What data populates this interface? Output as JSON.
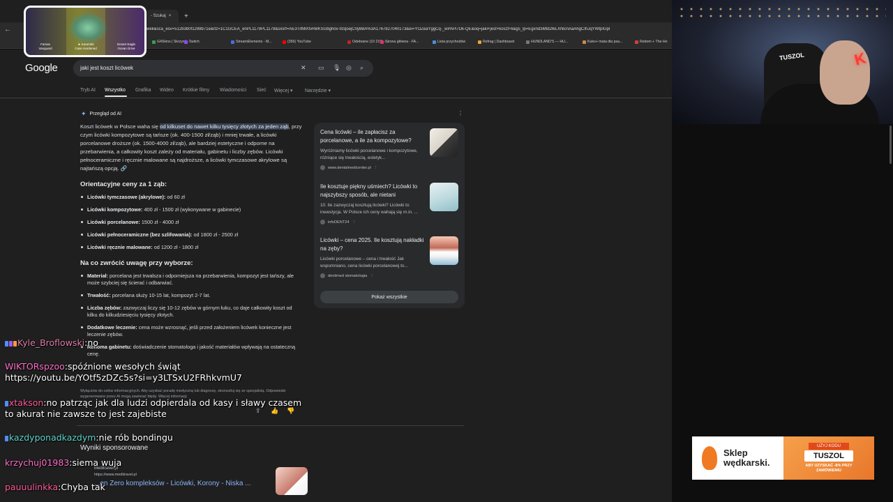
{
  "browser": {
    "tab_label": "- Szukaj",
    "new_tab": "+",
    "url": "wek&sca_esv=512b3b0f1298b71e&rlz=1C1GCEA_enPL1179PL1179&sxsrf=AE3TifMlXtvRBKSGbghov-9zqoejC0y8BA%3A1767827040173&ei=YOZeaYggCq-_wPAPi7Dk-QE&oq=jaki+jest+koszt+li&gs_lp=Egxnd3Mtd2l6LXNlcnAaAhgCIhJqYWtpIGpl",
    "bookmarks": [
      "G4Skins | Skrzynki -...",
      "Twitch",
      "StreamElements - M...",
      "(356) YouTube",
      "Odebrane (10 219) -...",
      "Strona główna - FA...",
      "Lista przychodów",
      "Refrag | Dashboard",
      "HUNDLAND'S — HU...",
      "Kuko+ mata dla psa...",
      "Rebom + The Ho"
    ]
  },
  "google": {
    "logo": "Google",
    "query": "jaki jest koszt licówek",
    "tabs": [
      "Tryb AI",
      "Wszystko",
      "Grafika",
      "Wideo",
      "Krótkie filmy",
      "Wiadomości",
      "Sieć",
      "Więcej ▾",
      "Narzędzie ▾"
    ],
    "ai_heading": "Przegląd od AI",
    "ai_intro_pre": "Koszt licówek w Polsce waha się ",
    "ai_intro_hl": "od kilkuset do nawet kilku tysięcy złotych za jeden ząb",
    "ai_intro_post": ", przy czym licówki kompozytowe są tańsze (ok. 400-1500 zł/ząb) i mniej trwałe, a licówki porcelanowe droższe (ok. 1500-4000 zł/ząb), ale bardziej estetyczne i odporne na przebarwienia, a całkowity koszt zależy od materiału, gabinetu i liczby zębów. Licówki pełnoceramiczne i ręcznie malowane są najdroższe, a licówki tymczasowe akrylowe są najtańszą opcją.",
    "h_prices": "Orientacyjne ceny za 1 ząb:",
    "prices": [
      {
        "b": "Licówki tymczasowe (akrylowe):",
        "t": " od 60 zł"
      },
      {
        "b": "Licówki kompozytowe:",
        "t": " 400 zł - 1500 zł (wykonywane w gabinecie)"
      },
      {
        "b": "Licówki porcelanowe:",
        "t": " 1500 zł - 4000 zł"
      },
      {
        "b": "Licówki pełnoceramiczne (bez szlifowania):",
        "t": " od 1800 zł - 2500 zł"
      },
      {
        "b": "Licówki ręcznie malowane:",
        "t": " od 1200 zł - 1800 zł"
      }
    ],
    "h_attention": "Na co zwrócić uwagę przy wyborze:",
    "attention": [
      {
        "b": "Materiał:",
        "t": " porcelana jest trwalsza i odporniejsza na przebarwienia, kompozyt jest tańszy, ale może szybciej się ścierać i odbarwiać."
      },
      {
        "b": "Trwałość:",
        "t": " porcelana służy 10-15 lat, kompozyt 2-7 lat."
      },
      {
        "b": "Liczba zębów:",
        "t": " zazwyczaj liczy się 10-12 zębów w górnym łuku, co daje całkowity koszt od kilku do kilkudziesięciu tysięcy złotych."
      },
      {
        "b": "Dodatkowe leczenie:",
        "t": " cena może wzrosnąć, jeśli przed założeniem licówek konieczne jest leczenie zębów."
      },
      {
        "b": "Renoma gabinetu:",
        "t": " doświadczenie stomatologa i jakość materiałów wpływają na ostateczną cenę."
      }
    ],
    "sources": [
      {
        "title": "Cena licówki – ile zapłacisz za porcelanowe, a ile za kompozytowe?",
        "desc": "Wyróżniamy licówki porcelanowe i kompozytowe, różniące się trwałością, estetyk...",
        "src": "www.dentalmedicenter.pl"
      },
      {
        "title": "Ile kosztuje piękny uśmiech? Licówki to najszybszy sposób, ale nietani",
        "desc": "10. Ile zazwyczaj kosztują licówki? Licówki to inwestycja. W Polsce ich ceny wahają się m.in. ...",
        "src": "infoDENT24"
      },
      {
        "title": "Licówki – cena 2025. Ile kosztują nakładki na zęby?",
        "desc": "Licówki porcelanowe – cena i trwałość Jak wspomniano, cena licówki porcelanowej to...",
        "src": "dentimed stomatologia"
      }
    ],
    "show_all": "Pokaż wszystkie",
    "disclaimer": "Wyłącznie do celów informacyjnych. Aby uzyskać poradę medyczną lub diagnozę, skonsultuj się ze specjalistą. Odpowiedzi wygenerowane przez AI mogą zawierać błędy. Więcej informacji",
    "sponsored": "Wyniki sponsorowane",
    "ad_site": "Meditravel.pl",
    "ad_url": "https://www.meditravel.pl",
    "ad_title": "...en Zero kompleksów - Licówki, Korony - Niska ..."
  },
  "overlay": {
    "items": [
      "Famas\nVanguard",
      "★ Karambit\nCase Hardened",
      "Desert Eagle\nOcean Drive"
    ]
  },
  "webcam": {
    "chair_logo": "TUSZOL",
    "neon": "K"
  },
  "chat": [
    {
      "user": "Kyle_Broflowski",
      "color": "#e07ea8",
      "msg": "no"
    },
    {
      "user": "WIKTORspzoo",
      "color": "#ff6ec7",
      "msg": "spóźnione wesołych świąt https://youtu.be/YOtf5zDZc5s?si=y3LTSxU2FRhkvmU7"
    },
    {
      "user": "xtakson",
      "color": "#ff5c9a",
      "msg": "no patrząc jak dla ludzi odpierdala od kasy i sławy czasem to akurat nie zawsze to jest zajebiste"
    },
    {
      "user": "kazdyponadkazdym",
      "color": "#5ed6c9",
      "msg": "nie rób bondingu"
    },
    {
      "user": "krzychuj01983",
      "color": "#ff6ec7",
      "msg": "siema wuja"
    },
    {
      "user": "pauuulinkka",
      "color": "#ff5c9a",
      "msg": "Chyba tak"
    }
  ],
  "banner": {
    "shop_line1": "Sklep",
    "shop_line2": "wędkarski.",
    "code_top": "UŻYJ KODU",
    "code": "TUSZOL",
    "code_sub": "ABY UZYSKAĆ -8% PRZY ZAMÓWIENIU"
  },
  "colors": {
    "accent": "#8ab4f8",
    "highlight": "#394457",
    "brand_orange": "#f07a22"
  }
}
